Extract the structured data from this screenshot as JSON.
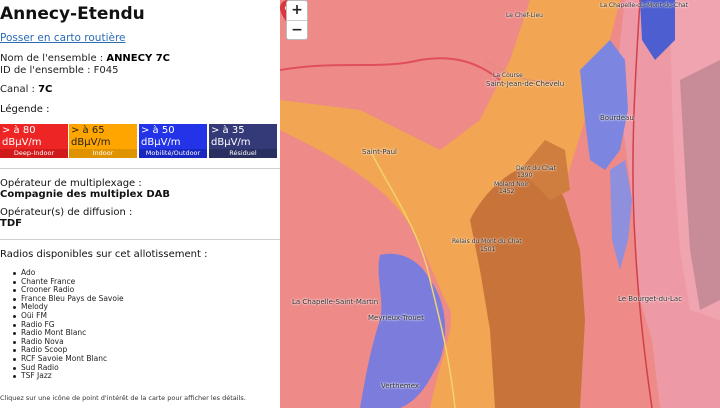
{
  "sidebar": {
    "title": "Annecy-Etendu",
    "road_link": "Posser en carto routière",
    "ensemble_name_label": "Nom de l'ensemble : ",
    "ensemble_name_value": "ANNECY 7C",
    "ensemble_id_label": "ID de l'ensemble : ",
    "ensemble_id_value": "F045",
    "canal_label": "Canal : ",
    "canal_value": "7C",
    "legend_label": "Légende :",
    "legend": [
      {
        "value": "> à 80 dBµV/m",
        "caption": "Deep-Indoor",
        "color": "#ee2525"
      },
      {
        "value": "> à 65 dBµV/m",
        "caption": "Indoor",
        "color": "#ffa500"
      },
      {
        "value": "> à 50 dBµV/m",
        "caption": "Mobilité/Outdoor",
        "color": "#2233e8"
      },
      {
        "value": "> à 35 dBµV/m",
        "caption": "Résiduel",
        "color": "#343a77"
      }
    ],
    "operator_label": "Opérateur de multiplexage :",
    "operator_value": "Compagnie des multiplex DAB",
    "broadcast_label": "Opérateur(s) de diffusion :",
    "broadcast_value": "TDF",
    "radios_title": "Radios disponibles sur cet allotissement :",
    "radios": [
      "Ado",
      "Chante France",
      "Crooner Radio",
      "France Bleu Pays de Savoie",
      "Melody",
      "Oüi FM",
      "Radio FG",
      "Radio Mont Blanc",
      "Radio Nova",
      "Radio Scoop",
      "RCF Savoie Mont Blanc",
      "Sud Radio",
      "TSF Jazz"
    ],
    "hint": "Cliquez sur une icône de point d'intérêt de la carte pour afficher les détails."
  },
  "map": {
    "zoom_in": "+",
    "zoom_out": "−",
    "places": [
      "La Chapelle-du-Mont-du-Chat",
      "Le Chef-Lieu",
      "La Course",
      "Saint-Jean-de-Chevelu",
      "Bourdeau",
      "Saint-Paul",
      "Dent du Chat",
      "1390",
      "Molard Noir",
      "1452",
      "Relais du Mont du Chat",
      "1501",
      "La Chapelle-Saint-Martin",
      "Meyrieux-Trouet",
      "Le Bourget-du-Lac",
      "Verthemex"
    ]
  }
}
